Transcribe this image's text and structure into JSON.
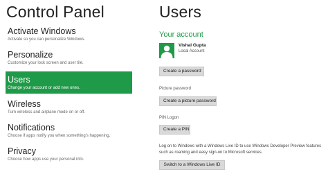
{
  "left_title": "Control Panel",
  "right_title": "Users",
  "nav": [
    {
      "label": "Activate Windows",
      "desc": "Activate so you can personalize Windows."
    },
    {
      "label": "Personalize",
      "desc": "Customize your lock screen and user tile."
    },
    {
      "label": "Users",
      "desc": "Change your account or add new ones."
    },
    {
      "label": "Wireless",
      "desc": "Turn wireless and airplane mode on or off."
    },
    {
      "label": "Notifications",
      "desc": "Choose if apps notify you when something's happening."
    },
    {
      "label": "Privacy",
      "desc": "Choose how apps use your personal info."
    }
  ],
  "account": {
    "heading": "Your account",
    "name": "Vishal Gupta",
    "type": "Local Account"
  },
  "buttons": {
    "create_password": "Create a password",
    "create_picture_password": "Create a picture password",
    "create_pin": "Create a PIN",
    "switch_live": "Switch to a Windows Live ID"
  },
  "labels": {
    "picture_password": "Picture password",
    "pin_logon": "PIN Logon",
    "live_info": "Log on to Windows with a Windows Live ID to use Windows Developer Preview features such as roaming and easy sign-on to Microsoft services."
  },
  "colors": {
    "accent": "#1f9a48",
    "button_bg": "#d9d9d9"
  },
  "icons": {
    "avatar": "user-silhouette-icon"
  }
}
